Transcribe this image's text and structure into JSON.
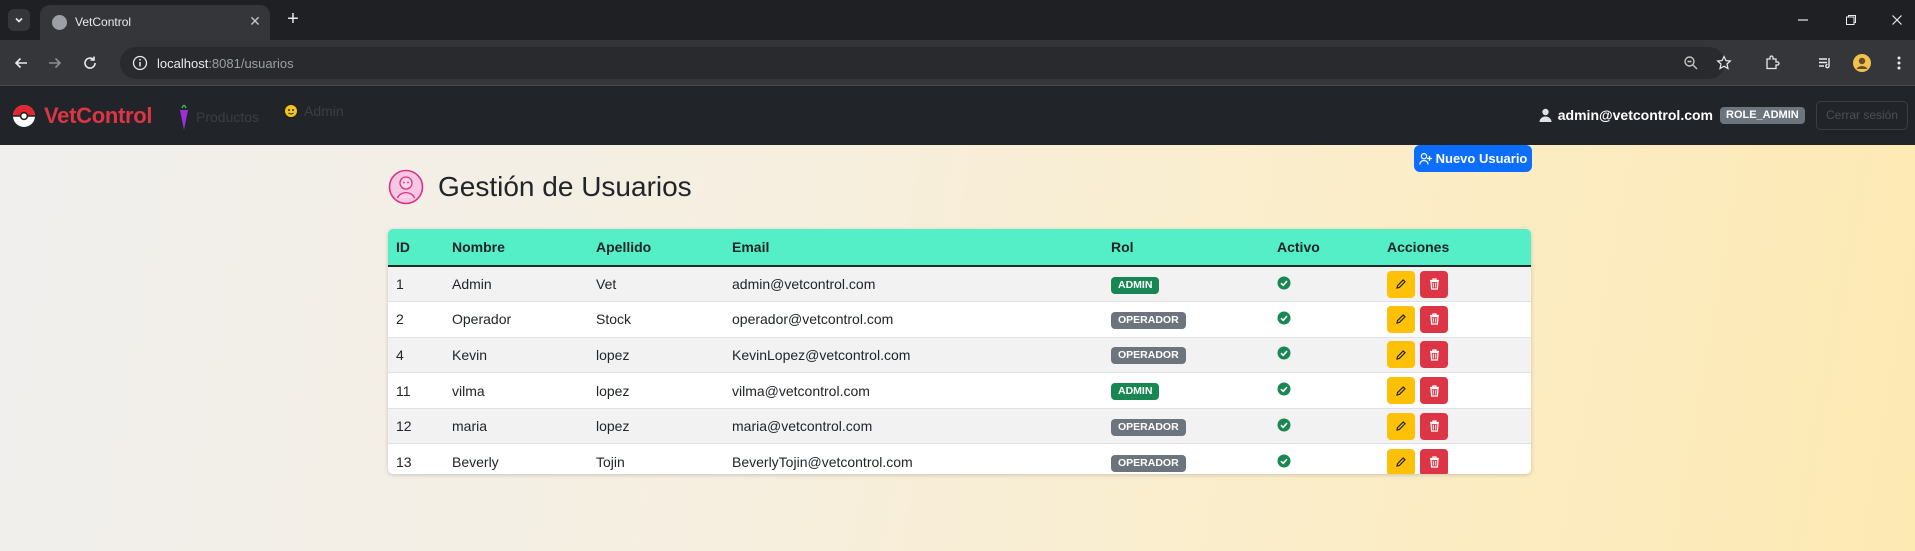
{
  "browser": {
    "tab_title": "VetControl",
    "url_host": "localhost",
    "url_rest": ":8081/usuarios"
  },
  "navbar": {
    "brand": "VetControl",
    "links": [
      {
        "label": "Productos",
        "icon": "carrot-icon"
      },
      {
        "label": "Admin",
        "icon": "emoji-icon"
      }
    ],
    "user_email": "admin@vetcontrol.com",
    "role": "ROLE_ADMIN",
    "logout": "Cerrar sesión"
  },
  "main": {
    "title": "Gestión de Usuarios",
    "new_user_button": "Nuevo Usuario"
  },
  "table": {
    "headers": [
      "ID",
      "Nombre",
      "Apellido",
      "Email",
      "Rol",
      "Activo",
      "Acciones"
    ],
    "rows": [
      {
        "id": "1",
        "nombre": "Admin",
        "apellido": "Vet",
        "email": "admin@vetcontrol.com",
        "rol": "ADMIN",
        "activo": true
      },
      {
        "id": "2",
        "nombre": "Operador",
        "apellido": "Stock",
        "email": "operador@vetcontrol.com",
        "rol": "OPERADOR",
        "activo": true
      },
      {
        "id": "4",
        "nombre": "Kevin",
        "apellido": "lopez",
        "email": "KevinLopez@vetcontrol.com",
        "rol": "OPERADOR",
        "activo": true
      },
      {
        "id": "11",
        "nombre": "vilma",
        "apellido": "lopez",
        "email": "vilma@vetcontrol.com",
        "rol": "ADMIN",
        "activo": true
      },
      {
        "id": "12",
        "nombre": "maria",
        "apellido": "lopez",
        "email": "maria@vetcontrol.com",
        "rol": "OPERADOR",
        "activo": true
      },
      {
        "id": "13",
        "nombre": "Beverly",
        "apellido": "Tojin",
        "email": "BeverlyTojin@vetcontrol.com",
        "rol": "OPERADOR",
        "activo": true
      }
    ]
  },
  "colors": {
    "brand": "#dc3545",
    "table_header": "#54efc6",
    "admin_badge": "#198754",
    "operador_badge": "#6c757d",
    "primary": "#0d6efd"
  }
}
